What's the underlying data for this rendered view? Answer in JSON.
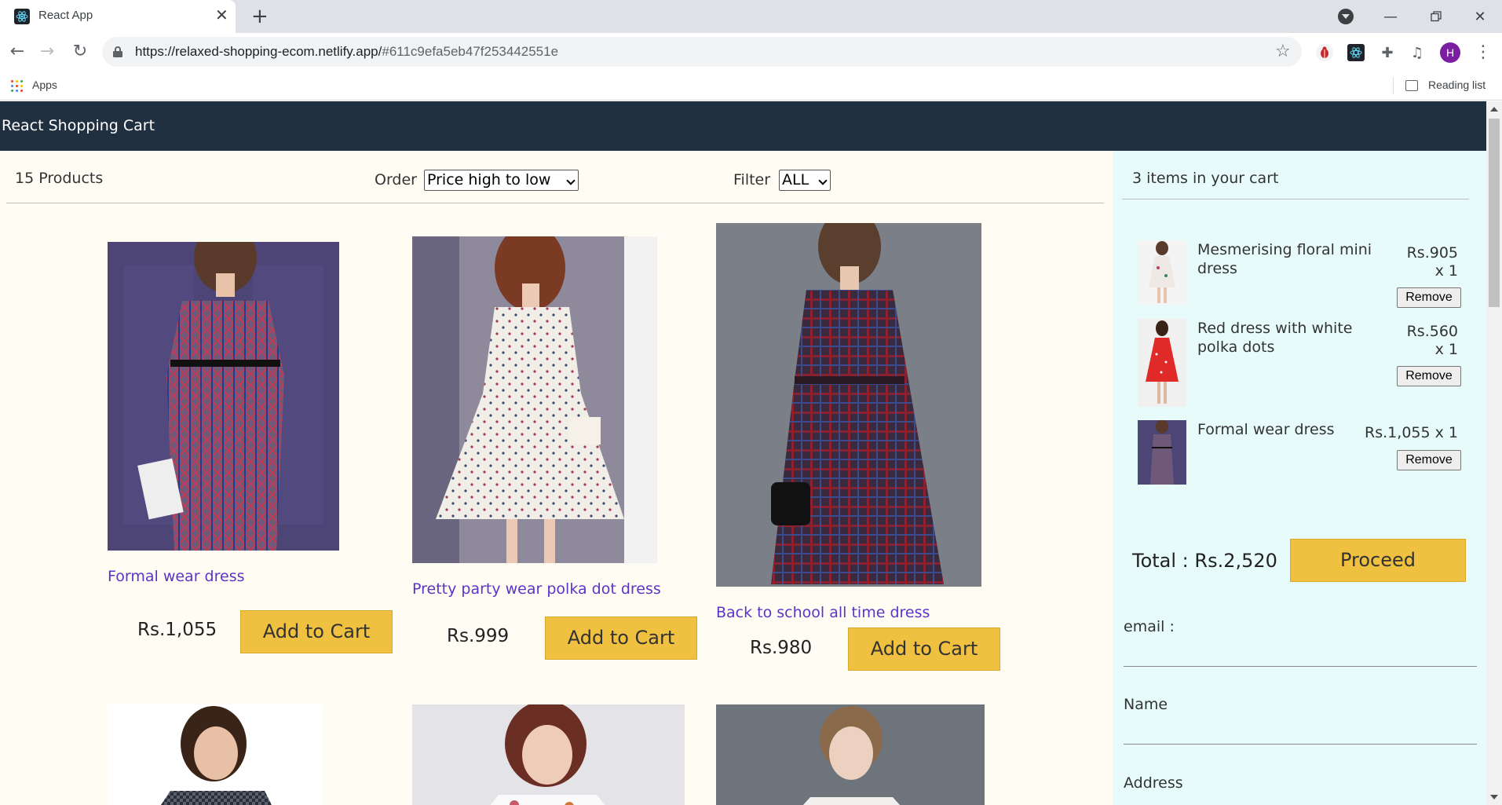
{
  "browser": {
    "tab_title": "React App",
    "url_host": "https://relaxed-shopping-ecom.netlify.app/",
    "url_hash": "#611c9efa5eb47f253442551e",
    "avatar_letter": "H",
    "bookmark_apps": "Apps",
    "reading_list": "Reading list",
    "accent": "#7b1fa2"
  },
  "app": {
    "title": "React Shopping Cart",
    "header_color": "#203040",
    "page_bg": "#fffdf3",
    "cart_bg": "#e8fbfb",
    "button_color": "#f0c040",
    "link_color": "#5a34c8"
  },
  "filter": {
    "count": "15 Products",
    "order_label": "Order",
    "order_value": "Price high to low",
    "filter_label": "Filter",
    "filter_value": "ALL"
  },
  "products": [
    {
      "title": "Formal wear dress",
      "price": "Rs.1,055",
      "button": "Add to Cart"
    },
    {
      "title": "Pretty party wear polka dot dress",
      "price": "Rs.999",
      "button": "Add to Cart"
    },
    {
      "title": "Back to school all time dress",
      "price": "Rs.980",
      "button": "Add to Cart"
    }
  ],
  "cart": {
    "header": "3 items in your cart",
    "items": [
      {
        "title": "Mesmerising floral mini dress",
        "price": "Rs.905",
        "qty": "x 1",
        "remove": "Remove"
      },
      {
        "title": "Red dress with white polka dots",
        "price": "Rs.560",
        "qty": "x 1",
        "remove": "Remove"
      },
      {
        "title": "Formal wear dress",
        "price": "Rs.1,055 x 1",
        "qty": "",
        "remove": "Remove"
      }
    ],
    "total": "Total : Rs.2,520",
    "proceed": "Proceed",
    "form": {
      "email_label": "email :",
      "name_label": "Name",
      "address_label": "Address"
    }
  }
}
